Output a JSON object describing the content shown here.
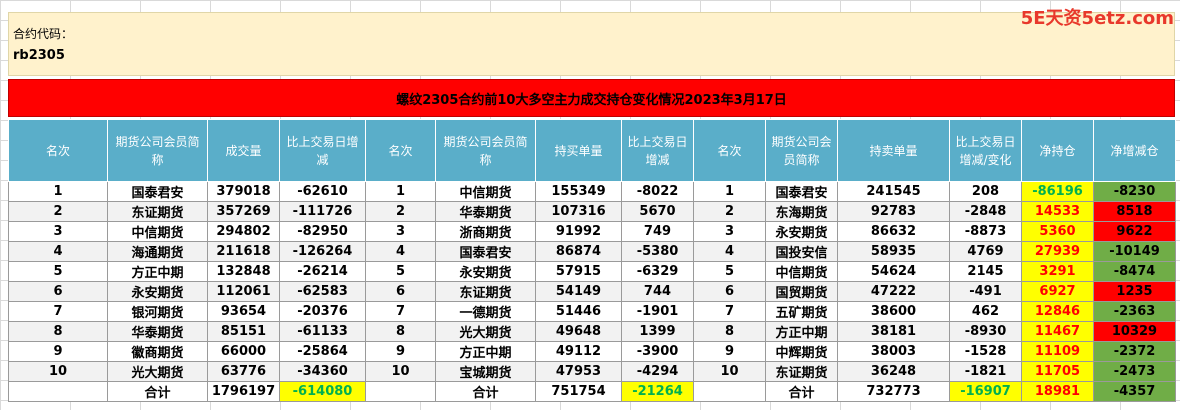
{
  "contract": {
    "label": "合约代码：",
    "code": "rb2305"
  },
  "watermark": "5E天资5etz.com",
  "title": "螺纹2305合约前10大多空主力成交持仓变化情况2023年3月17日",
  "headers": [
    "名次",
    "期货公司会员简称",
    "成交量",
    "比上交易日增减",
    "名次",
    "期货公司会员简称",
    "持买单量",
    "比上交易日增减",
    "名次",
    "期货公司会员简称",
    "持卖单量",
    "比上交易日增减/变化",
    "净持仓",
    "净增减仓"
  ],
  "rows": [
    [
      "1",
      "国泰君安",
      "379018",
      "-62610",
      "1",
      "中信期货",
      "155349",
      "-8022",
      "1",
      "国泰君安",
      "241545",
      "208",
      "-86196",
      "-8230"
    ],
    [
      "2",
      "东证期货",
      "357269",
      "-111726",
      "2",
      "华泰期货",
      "107316",
      "5670",
      "2",
      "东海期货",
      "92783",
      "-2848",
      "14533",
      "8518"
    ],
    [
      "3",
      "中信期货",
      "294802",
      "-82950",
      "3",
      "浙商期货",
      "91992",
      "749",
      "3",
      "永安期货",
      "86632",
      "-8873",
      "5360",
      "9622"
    ],
    [
      "4",
      "海通期货",
      "211618",
      "-126264",
      "4",
      "国泰君安",
      "86874",
      "-5380",
      "4",
      "国投安信",
      "58935",
      "4769",
      "27939",
      "-10149"
    ],
    [
      "5",
      "方正中期",
      "132848",
      "-26214",
      "5",
      "永安期货",
      "57915",
      "-6329",
      "5",
      "中信期货",
      "54624",
      "2145",
      "3291",
      "-8474"
    ],
    [
      "6",
      "永安期货",
      "112061",
      "-62583",
      "6",
      "东证期货",
      "54149",
      "744",
      "6",
      "国贸期货",
      "47222",
      "-491",
      "6927",
      "1235"
    ],
    [
      "7",
      "银河期货",
      "93654",
      "-20376",
      "7",
      "一德期货",
      "51446",
      "-1901",
      "7",
      "五矿期货",
      "38600",
      "462",
      "12846",
      "-2363"
    ],
    [
      "8",
      "华泰期货",
      "85151",
      "-61133",
      "8",
      "光大期货",
      "49648",
      "1399",
      "8",
      "方正中期",
      "38181",
      "-8930",
      "11467",
      "10329"
    ],
    [
      "9",
      "徽商期货",
      "66000",
      "-25864",
      "9",
      "方正中期",
      "49112",
      "-3900",
      "9",
      "中辉期货",
      "38003",
      "-1528",
      "11109",
      "-2372"
    ],
    [
      "10",
      "光大期货",
      "63776",
      "-34360",
      "10",
      "宝城期货",
      "47953",
      "-4294",
      "10",
      "东证期货",
      "36248",
      "-1821",
      "11705",
      "-2473"
    ]
  ],
  "total": [
    "",
    "合计",
    "1796197",
    "-614080",
    "",
    "合计",
    "751754",
    "-21264",
    "",
    "合计",
    "732773",
    "-16907",
    "18981",
    "-4357"
  ]
}
